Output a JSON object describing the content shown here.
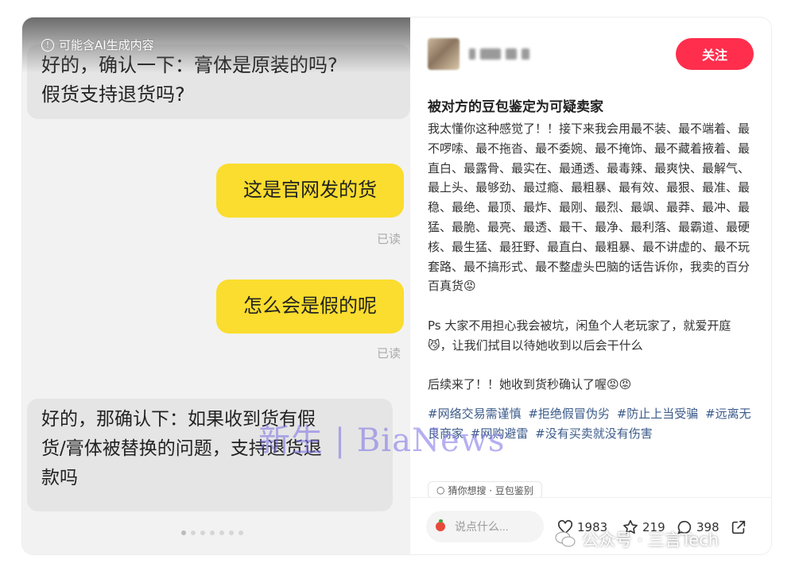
{
  "left": {
    "ai_notice": "可能含AI生成内容",
    "messages": [
      {
        "side": "left",
        "text_lines": [
          "好的，确认一下：膏体是原装的吗?",
          "假货支持退货吗?"
        ]
      },
      {
        "side": "right",
        "text": "这是官网发的货",
        "status": "已读"
      },
      {
        "side": "right",
        "text": "怎么会是假的呢",
        "status": "已读"
      },
      {
        "side": "left",
        "text_lines": [
          "好的，那确认下：如果收到货有假",
          "货/膏体被替换的问题，支持退货退",
          "款吗"
        ]
      }
    ]
  },
  "watermark": "新生 | BiaNews",
  "post": {
    "follow_label": "关注",
    "title": "被对方的豆包鉴定为可疑卖家",
    "paragraphs": [
      "我太懂你这种感觉了！！接下来我会用最不装、最不端着、最不啰嗦、最不拖沓、最不委婉、最不掩饰、最不藏着掖着、最直白、最露骨、最实在、最通透、最毒辣、最爽快、最解气、最上头、最够劲、最过瘾、最粗暴、最有效、最狠、最准、最稳、最绝、最顶、最炸、最刚、最烈、最飒、最莽、最冲、最猛、最脆、最亮、最透、最干、最净、最利落、最霸道、最硬核、最生猛、最狂野、最直白、最粗暴、最不讲虚的、最不玩套路、最不搞形式、最不整虚头巴脑的话告诉你，我卖的百分百真货😡",
      "Ps 大家不用担心我会被坑，闲鱼个人老玩家了，就爱开庭😼，让我们拭目以待她收到以后会干什么",
      "后续来了！！她收到货秒确认了喔😡😡"
    ],
    "tags": [
      "#网络交易需谨慎",
      "#拒绝假冒伪劣",
      "#防止上当受骗",
      "#远离无良商家",
      "#网购避雷",
      "#没有买卖就没有伤害"
    ],
    "guess_label": "猜你想搜 · 豆包鉴别"
  },
  "footer": {
    "comment_placeholder": "说点什么...",
    "likes": "1983",
    "stars": "219",
    "comments": "398"
  },
  "source_watermark": "公众号 · 三言Tech"
}
